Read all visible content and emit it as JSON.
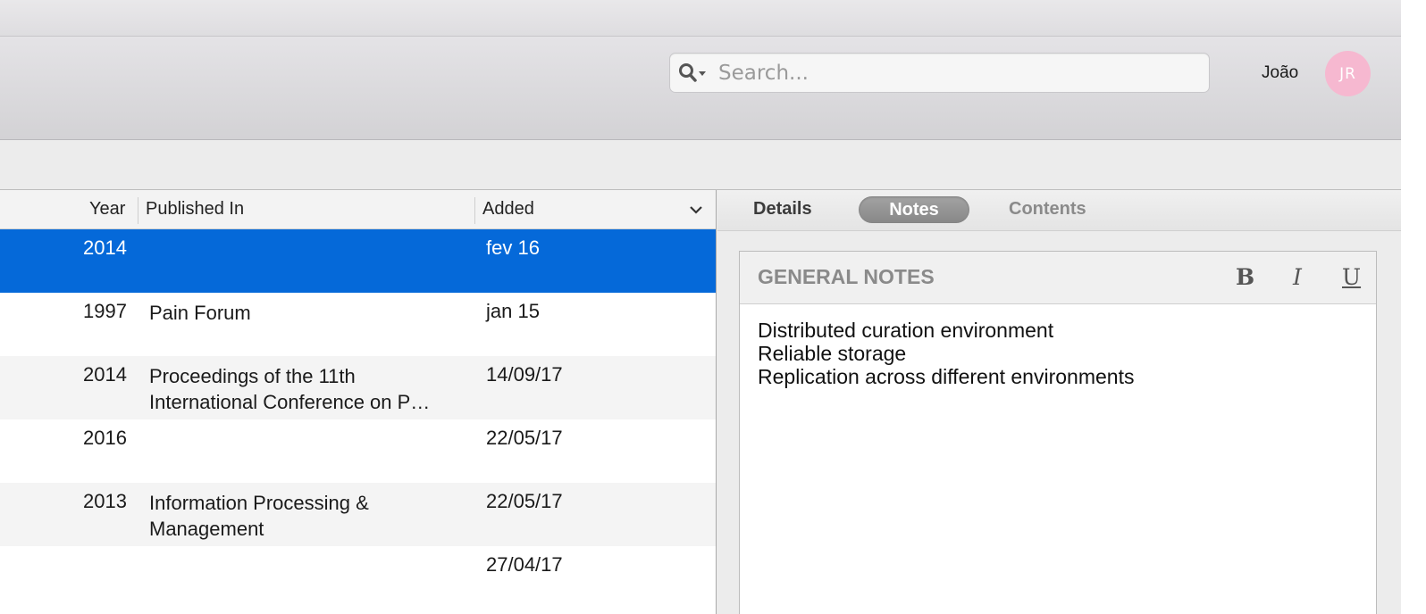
{
  "search": {
    "placeholder": "Search..."
  },
  "user": {
    "name": "João",
    "initials": "JR"
  },
  "table": {
    "columns": {
      "year": "Year",
      "published_in": "Published In",
      "added": "Added"
    },
    "rows": [
      {
        "year": "2014",
        "published_in": "",
        "added": "fev 16",
        "selected": true
      },
      {
        "year": "1997",
        "published_in": "Pain Forum",
        "added": "jan 15"
      },
      {
        "year": "2014",
        "published_in": "Proceedings of the 11th International Conference on P…",
        "added": "14/09/17"
      },
      {
        "year": "2016",
        "published_in": "",
        "added": "22/05/17"
      },
      {
        "year": "2013",
        "published_in": "Information Processing & Management",
        "added": "22/05/17"
      },
      {
        "year": "",
        "published_in": "",
        "added": "27/04/17"
      }
    ]
  },
  "panel": {
    "tabs": {
      "details": "Details",
      "notes": "Notes",
      "contents": "Contents"
    },
    "active_tab": "Notes",
    "notes": {
      "title": "GENERAL NOTES",
      "format": {
        "bold": "B",
        "italic": "I",
        "underline": "U"
      },
      "lines": [
        "Distributed curation environment",
        "Reliable storage",
        "Replication across different environments"
      ]
    }
  },
  "colors": {
    "selection": "#0569d9",
    "avatar": "#f6b8d0"
  },
  "icons": {
    "search": "search-icon",
    "sort": "chevron-down-icon"
  }
}
